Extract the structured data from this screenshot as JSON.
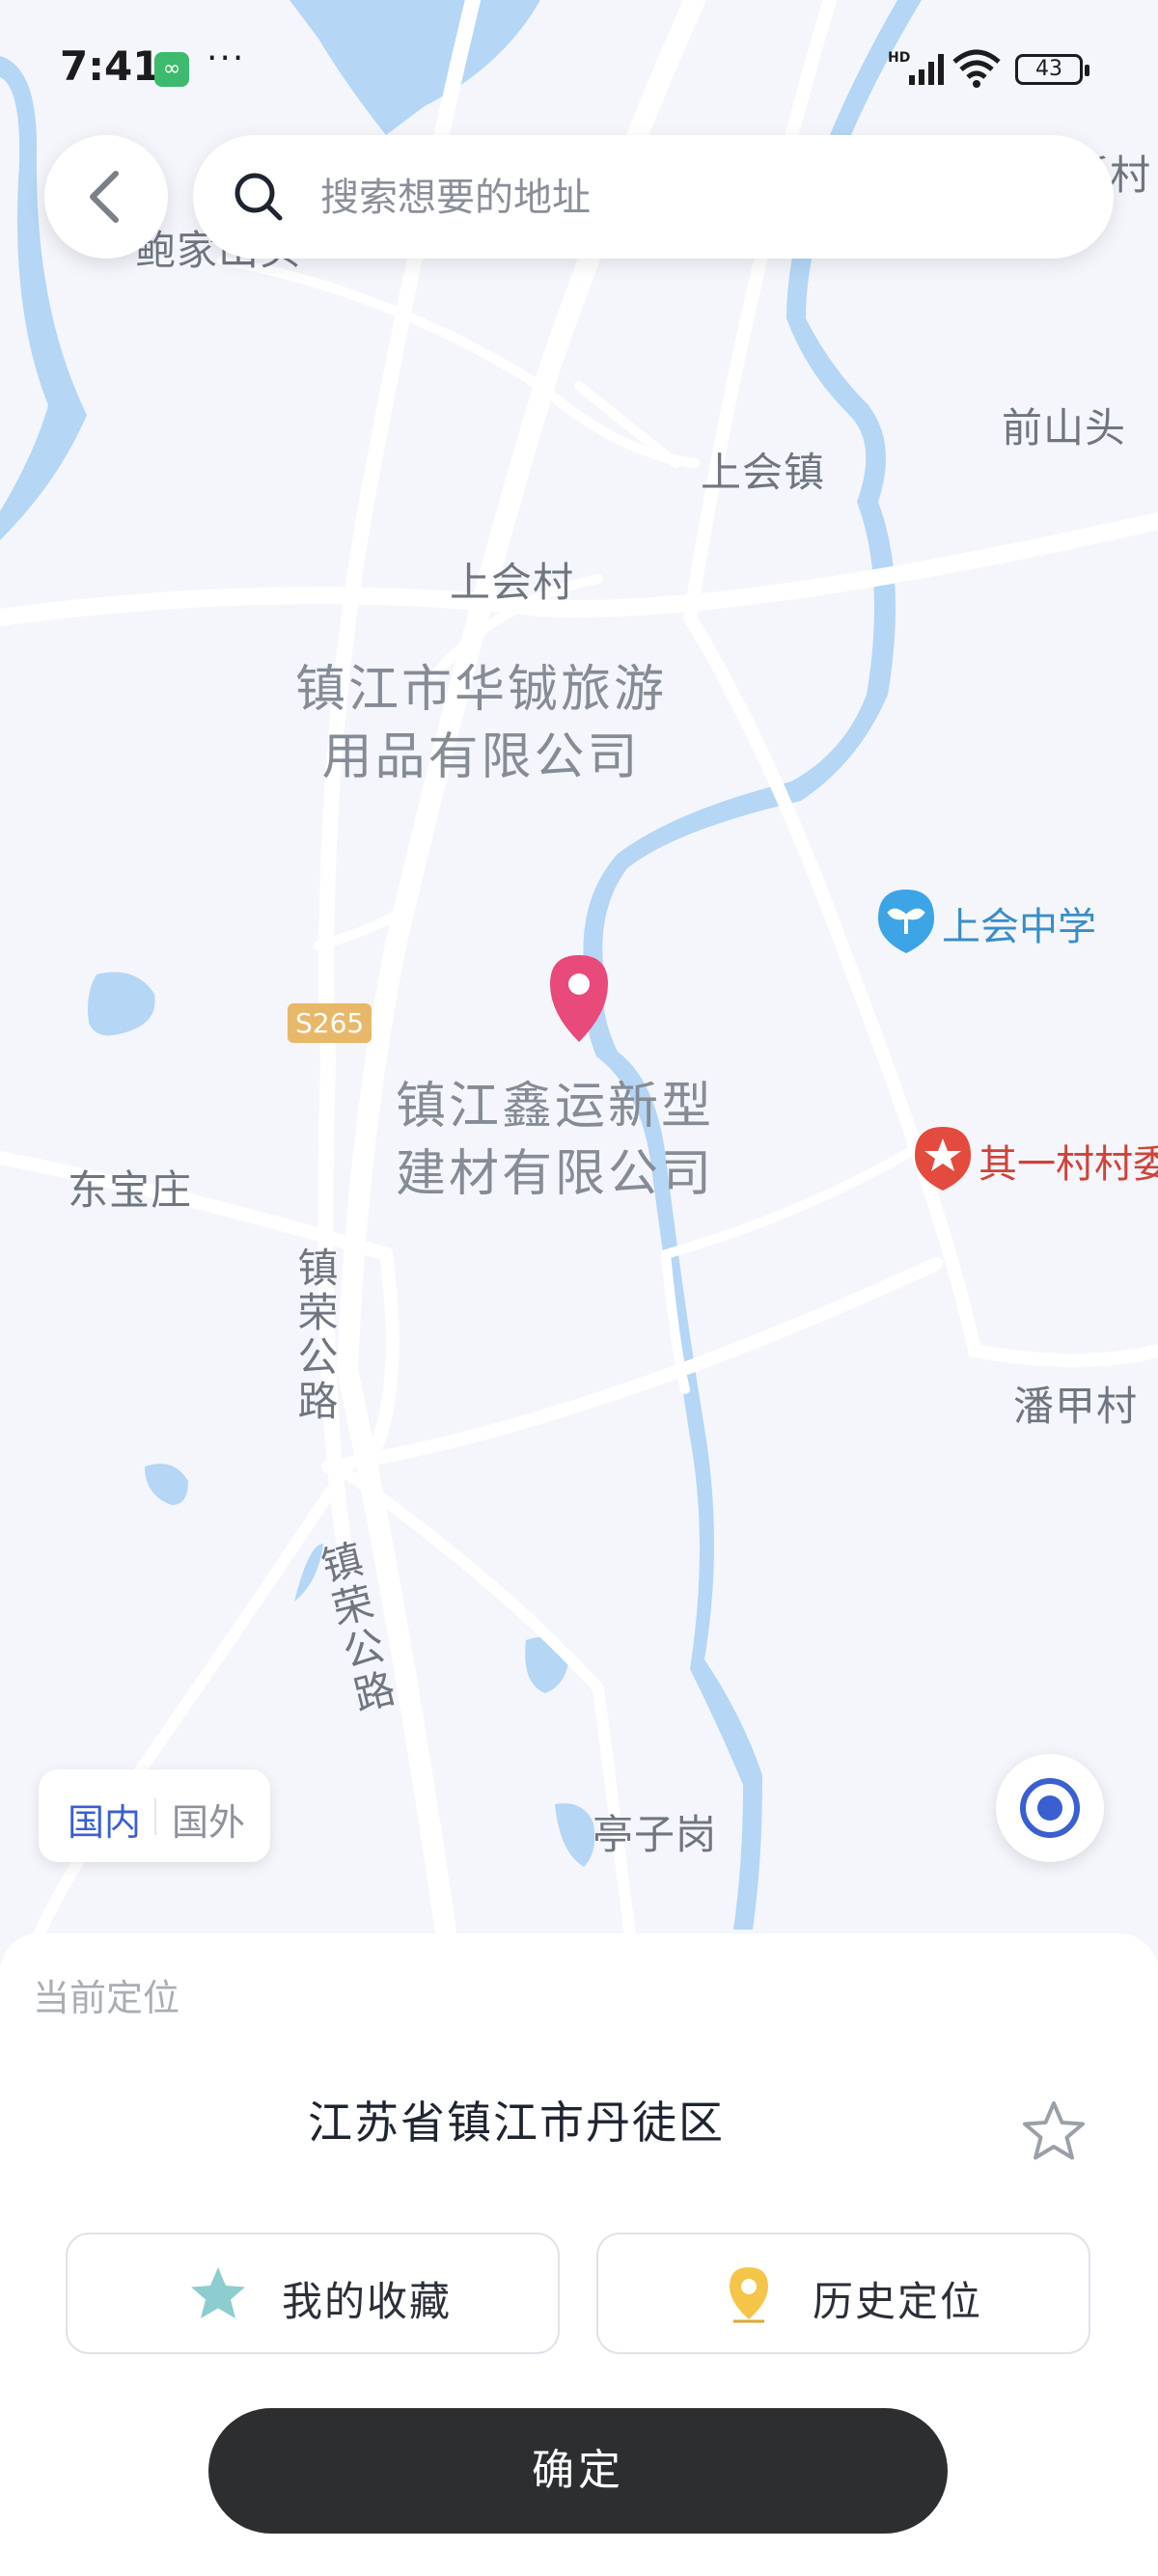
{
  "status_bar": {
    "time": "7:41",
    "more": "···",
    "network": "HD",
    "battery": "43"
  },
  "search": {
    "placeholder": "搜索想要的地址"
  },
  "map": {
    "labels": {
      "baojia": "鲍家山头",
      "xixincun": "西新村",
      "qianshantou": "前山头",
      "shanghuizhen": "上会镇",
      "shanghuicun": "上会村",
      "huacheng": "镇江市华铖旅游\n用品有限公司",
      "xinyun": "镇江鑫运新型\n建材有限公司",
      "dongbaozhuang": "东宝庄",
      "panjiacun": "潘甲村",
      "tingzigang": "亭子岗",
      "road1": "镇荣公路",
      "road2": "镇荣公路",
      "shield": "S265"
    },
    "pois": {
      "school": "上会中学",
      "village_committee": "其一村村委"
    },
    "colors": {
      "water": "#b5d6f5",
      "road": "#ffffff",
      "land": "#f4f6fb",
      "pin": "#e84a7a"
    }
  },
  "region_toggle": {
    "domestic": "国内",
    "abroad": "国外",
    "selected": "国内"
  },
  "sheet": {
    "caption": "当前定位",
    "address": "江苏省镇江市丹徒区",
    "favorites_label": "我的收藏",
    "history_label": "历史定位",
    "confirm_label": "确定"
  },
  "icons": [
    "chevron-left-icon",
    "search-icon",
    "star-outline-icon",
    "star-icon",
    "location-pin-icon",
    "locate-target-icon",
    "map-pin-icon",
    "school-icon"
  ]
}
